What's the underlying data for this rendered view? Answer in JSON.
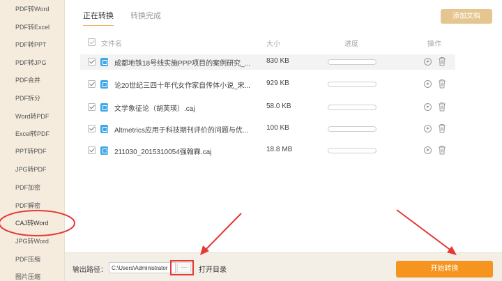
{
  "sidebar": {
    "items": [
      {
        "label": "PDF转Word"
      },
      {
        "label": "PDF转Excel"
      },
      {
        "label": "PDF转PPT"
      },
      {
        "label": "PDF转JPG"
      },
      {
        "label": "PDF合并"
      },
      {
        "label": "PDF拆分"
      },
      {
        "label": "Word转PDF"
      },
      {
        "label": "Excel转PDF"
      },
      {
        "label": "PPT转PDF"
      },
      {
        "label": "JPG转PDF"
      },
      {
        "label": "PDF加密"
      },
      {
        "label": "PDF解密"
      },
      {
        "label": "CAJ转Word"
      },
      {
        "label": "JPG转Word"
      },
      {
        "label": "PDF压缩"
      },
      {
        "label": "图片压缩"
      }
    ],
    "active_index": 12
  },
  "tabs": [
    {
      "label": "正在转换"
    },
    {
      "label": "转换完成"
    }
  ],
  "add_button": "添加文档",
  "table": {
    "headers": {
      "name": "文件名",
      "size": "大小",
      "progress": "进度",
      "action": "操作"
    },
    "rows": [
      {
        "name": "成都地铁18号线实施PPP项目的案例研究_...",
        "size": "830 KB",
        "progress": 0
      },
      {
        "name": "论20世纪三四十年代女作家自传体小说_宋...",
        "size": "929 KB",
        "progress": 0
      },
      {
        "name": "文学象征论（胡芙瑛）.caj",
        "size": "58.0 KB",
        "progress": 0
      },
      {
        "name": "Altmetrics应用于科技期刊评价的问题与优...",
        "size": "100 KB",
        "progress": 0
      },
      {
        "name": "211030_2015310054强翰霖.caj",
        "size": "18.8 MB",
        "progress": 0
      }
    ]
  },
  "bottom": {
    "output_label": "输出路径：",
    "path_value": "C:\\Users\\Administrator",
    "browse_label": "···",
    "open_dir": "打开目录",
    "start_button": "开始转换"
  },
  "colors": {
    "accent": "#f5951f",
    "annotation": "#e53935",
    "sidebar_bg": "#f5ecdd"
  }
}
